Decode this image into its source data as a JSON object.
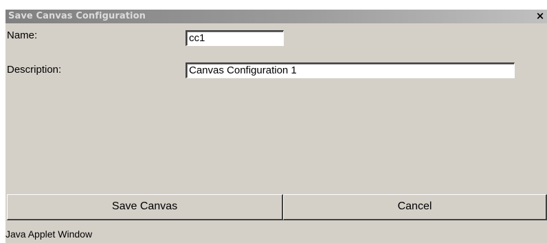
{
  "window": {
    "title": "Save Canvas Configuration",
    "close_glyph": "×",
    "close_icon": "close-icon"
  },
  "form": {
    "name_label": "Name:",
    "name_value": "cc1",
    "description_label": "Description:",
    "description_value": "Canvas Configuration 1"
  },
  "buttons": {
    "save_label": "Save Canvas",
    "cancel_label": "Cancel"
  },
  "status": {
    "text": "Java Applet Window"
  },
  "colors": {
    "window_background": "#d4d0c8",
    "titlebar_gradient_start": "#808080",
    "titlebar_gradient_end": "#c0c0c0",
    "title_text": "#dcdcdc"
  }
}
